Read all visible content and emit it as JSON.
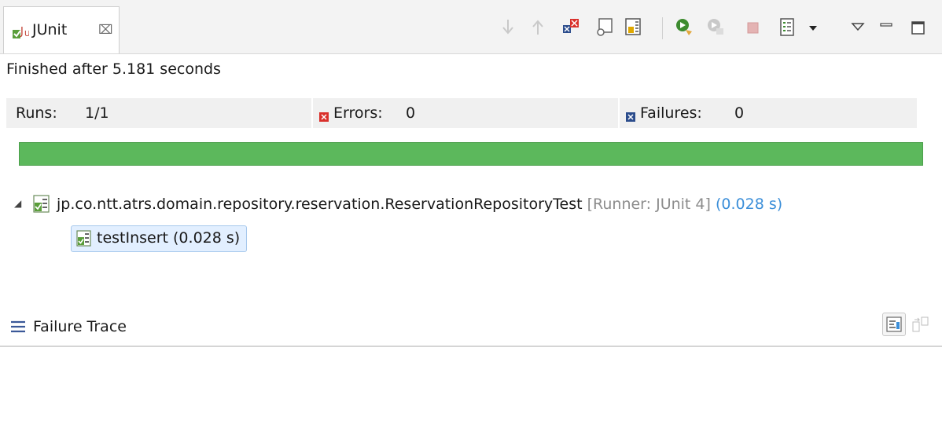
{
  "view": {
    "tab_title": "JUnit",
    "tab_close_glyph": "⌧",
    "tab_icon": "junit-icon"
  },
  "toolbar": {
    "buttons": [
      {
        "name": "next-failure-icon"
      },
      {
        "name": "previous-failure-icon"
      },
      {
        "name": "show-failures-only-icon"
      },
      {
        "name": "scroll-lock-icon"
      },
      {
        "name": "show-skipped-only-icon"
      },
      {
        "name": "rerun-test-icon"
      },
      {
        "name": "rerun-failed-first-icon"
      },
      {
        "name": "stop-icon"
      },
      {
        "name": "test-run-history-icon"
      },
      {
        "name": "history-dropdown-icon"
      },
      {
        "name": "view-menu-icon"
      },
      {
        "name": "minimize-icon"
      },
      {
        "name": "maximize-icon"
      }
    ]
  },
  "status": {
    "text": "Finished after 5.181 seconds"
  },
  "counters": {
    "runs_label": "Runs:",
    "runs_value": "1/1",
    "errors_label": "Errors:",
    "errors_value": "0",
    "failures_label": "Failures:",
    "failures_value": "0"
  },
  "progress": {
    "fraction": 1.0,
    "color": "#5cb85c"
  },
  "tree": {
    "suite": {
      "name": "jp.co.ntt.atrs.domain.repository.reservation.ReservationRepositoryTest",
      "runner": "[Runner: JUnit 4]",
      "time": "(0.028 s)"
    },
    "test": {
      "label": "testInsert (0.028 s)"
    }
  },
  "failure_trace": {
    "title": "Failure Trace"
  },
  "colors": {
    "pass_green": "#5cb85c",
    "error_red": "#d9302b",
    "failure_blue": "#2b4c8c",
    "time_blue": "#3c8fd9"
  }
}
